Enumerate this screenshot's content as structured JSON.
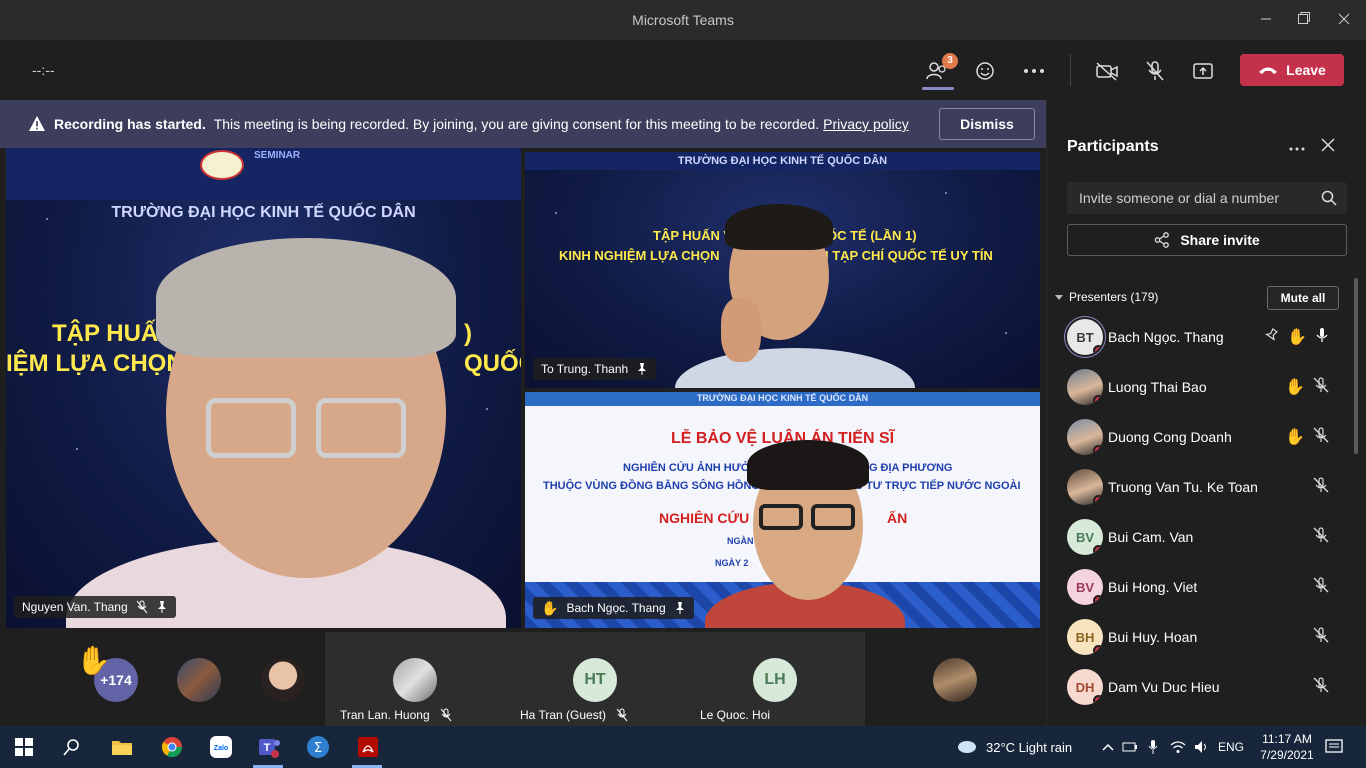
{
  "window": {
    "title": "Microsoft Teams"
  },
  "toolbar": {
    "timer": "--:--",
    "participants_count": "3",
    "leave_label": "Leave"
  },
  "banner": {
    "title": "Recording has started.",
    "text": "This meeting is being recorded. By joining, you are giving consent for this meeting to be recorded.",
    "link": "Privacy policy",
    "dismiss": "Dismiss"
  },
  "videos": {
    "main": {
      "name": "Nguyen Van. Thang",
      "slide_logo_text": "SEMINAR",
      "slide_line1": "TRƯỜNG ĐẠI HỌC KINH TẾ QUỐC DÂN",
      "slide_line2": "TẬP HUẤN V",
      "slide_line2b": ")",
      "slide_line3": "IỆM LỰA CHỌN V",
      "slide_line3b": "QUỐC"
    },
    "top_right": {
      "name": "To Trung. Thanh",
      "slide_line1": "TRƯỜNG ĐẠI HỌC KINH TẾ QUỐC DÂN",
      "slide_line2": "TẬP HUẤN V",
      "slide_line2b": "ỐC TẾ (LẦN 1)",
      "slide_line3": "KINH NGHIỆM LỰA CHỌN",
      "slide_line3b": "I TẠP CHÍ QUỐC TẾ UY TÍN"
    },
    "bottom_right": {
      "name": "Bach Ngọc. Thang",
      "slide_line1": "TRƯỜNG ĐẠI HỌC KINH TẾ QUỐC DÂN",
      "slide_line2": "LỄ BẢO VỆ LUẬN ÁN TIẾN SĨ",
      "slide_line3": "NGHIÊN CỨU ẢNH HƯỞNG",
      "slide_line3b": "NG ĐỊA PHƯƠNG",
      "slide_line4": "THUỘC VÙNG ĐỒNG BẰNG SÔNG HỒNG",
      "slide_line4b": "U TƯ TRỰC TIẾP NƯỚC NGOÀI",
      "slide_line5": "NGHIÊN CỨU",
      "slide_line5b": "ẤN",
      "slide_line6": "NGÀN",
      "slide_line7": "NGÀY 2"
    }
  },
  "strip": {
    "more_count": "+174",
    "cells": [
      {
        "name": "Tran Lan. Huong",
        "initials": ""
      },
      {
        "name": "Ha Tran (Guest)",
        "initials": "HT"
      },
      {
        "name": "Le Quoc. Hoi",
        "initials": "LH"
      }
    ]
  },
  "panel": {
    "title": "Participants",
    "invite_placeholder": "Invite someone or dial a number",
    "share_invite": "Share invite",
    "presenters_label": "Presenters (179)",
    "mute_all": "Mute all",
    "participants": [
      {
        "name": "Bach Ngọc. Thang",
        "initials": "BT",
        "avatar_color": "#e8e8e8",
        "text_color": "#3a3a3a",
        "photo": false,
        "pinned": true,
        "hand": true,
        "mic": "on"
      },
      {
        "name": "Luong Thai Bao",
        "initials": "",
        "avatar_color": "#6b7d8f",
        "text_color": "#fff",
        "photo": true,
        "pinned": false,
        "hand": true,
        "mic": "off"
      },
      {
        "name": "Duong Cong Doanh",
        "initials": "",
        "avatar_color": "#7a8fa6",
        "text_color": "#fff",
        "photo": true,
        "pinned": false,
        "hand": true,
        "mic": "off"
      },
      {
        "name": "Truong Van Tu. Ke Toan",
        "initials": "",
        "avatar_color": "#5e4a3c",
        "text_color": "#fff",
        "photo": true,
        "pinned": false,
        "hand": false,
        "mic": "off"
      },
      {
        "name": "Bui Cam. Van",
        "initials": "BV",
        "avatar_color": "#d7ead9",
        "text_color": "#4a7a55",
        "photo": false,
        "pinned": false,
        "hand": false,
        "mic": "off"
      },
      {
        "name": "Bui Hong. Viet",
        "initials": "BV",
        "avatar_color": "#f5d3df",
        "text_color": "#9b3a5c",
        "photo": false,
        "pinned": false,
        "hand": false,
        "mic": "off"
      },
      {
        "name": "Bui Huy. Hoan",
        "initials": "BH",
        "avatar_color": "#f7e4bf",
        "text_color": "#8a6420",
        "photo": false,
        "pinned": false,
        "hand": false,
        "mic": "off"
      },
      {
        "name": "Dam Vu Duc Hieu",
        "initials": "DH",
        "avatar_color": "#f8d9cf",
        "text_color": "#a24a2f",
        "photo": false,
        "pinned": false,
        "hand": false,
        "mic": "off"
      }
    ]
  },
  "taskbar": {
    "weather": "32°C  Light rain",
    "lang": "ENG",
    "time": "11:17 AM",
    "date": "7/29/2021"
  },
  "colors": {
    "accent": "#8b8cc7",
    "leave": "#c4314b",
    "banner": "#3d3d5c",
    "hand": "#f4b400"
  }
}
